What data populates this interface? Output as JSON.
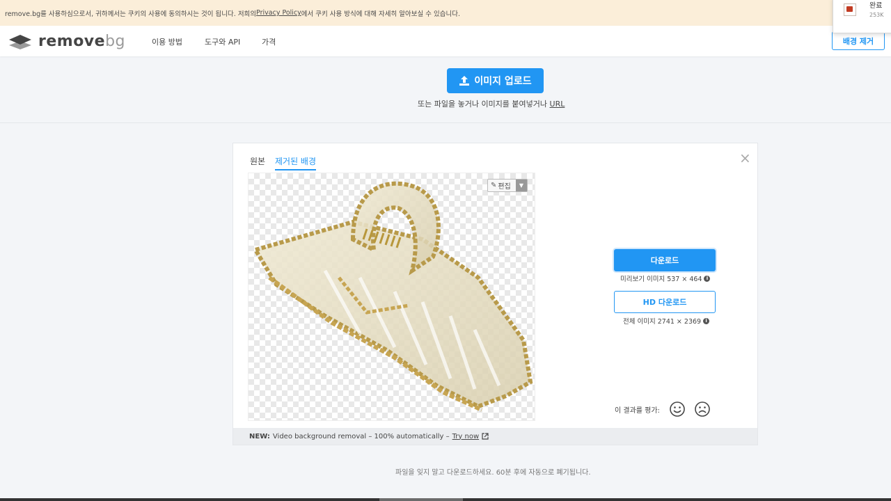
{
  "cookie_bar": {
    "text_before": "remove.bg를 사용하심으로서, 귀하께서는 쿠키의 사용에 동의하시는 것이 됩니다. 저희의 ",
    "link": "Privacy Policy",
    "text_after": "에서 쿠키 사용 방식에 대해 자세히 알아보실 수 있습니다."
  },
  "download_popup": {
    "title": "완료",
    "size": "253K"
  },
  "header": {
    "logo_main": "remove",
    "logo_sub": "bg",
    "nav": [
      "이용 방법",
      "도구와 API",
      "가격"
    ],
    "cta": "배경 제거"
  },
  "upload": {
    "button": "이미지 업로드",
    "hint": "또는 파일을 놓거나 이미지를 붙여넣거나 ",
    "url": "URL"
  },
  "result": {
    "tabs": [
      "원본",
      "제거된 배경"
    ],
    "active_tab": "제거된 배경",
    "close": "×",
    "edit_label": "편집",
    "download_label": "다운로드",
    "preview_info": "미리보기 이미지 537 × 464",
    "hd_label": "HD 다운로드",
    "full_info": "전체 이미지 2741 × 2369",
    "rate_label": "이 결과를 평가:",
    "footer_new": "NEW:",
    "footer_text": "Video background removal – 100% automatically –",
    "footer_link": "Try now"
  },
  "bottom_note": "파일을 잊지 말고 다운로드하세요. 60분 후에 자동으로 폐기됩니다.",
  "colors": {
    "accent": "#2196f3",
    "cookie_bg": "#fbeed9",
    "page_bg": "#f3f5f8"
  }
}
